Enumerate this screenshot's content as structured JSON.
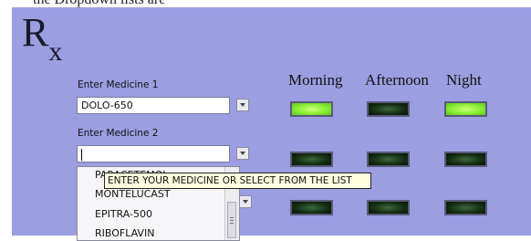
{
  "top_text": "the Dropdown lists are",
  "rx_symbol": {
    "r": "R",
    "x": "x"
  },
  "medicine1": {
    "label": "Enter Medicine 1",
    "value": "DOLO-650"
  },
  "medicine2": {
    "label": "Enter Medicine 2",
    "value": ""
  },
  "columns": {
    "morning": "Morning",
    "afternoon": "Afternoon",
    "night": "Night"
  },
  "leds": [
    {
      "row": 1,
      "morning": "on",
      "afternoon": "off",
      "night": "on"
    },
    {
      "row": 2,
      "morning": "off",
      "afternoon": "off",
      "night": "off"
    },
    {
      "row": 3,
      "morning": "off",
      "afternoon": "off",
      "night": "off"
    }
  ],
  "dropdown_list": [
    "PARACETEMOL",
    "MONTELUCAST",
    "EPITRA-500",
    "RIBOFLAVIN"
  ],
  "tooltip": "ENTER YOUR MEDICINE OR SELECT FROM THE LIST",
  "colors": {
    "panel": "#9b9ee0",
    "led_on": "#8ff03a",
    "led_off": "#163015",
    "tooltip_bg": "#ffffe1"
  }
}
